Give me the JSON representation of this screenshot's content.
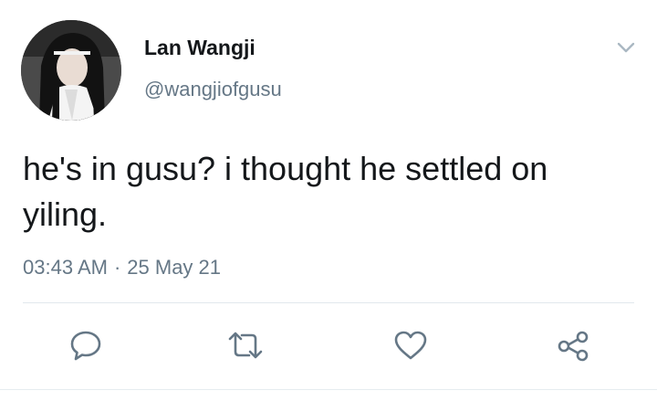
{
  "tweet": {
    "author": {
      "display_name": "Lan Wangji",
      "handle": "@wangjiofgusu",
      "avatar": "profile-photo"
    },
    "text": "he's in gusu? i thought he settled on yiling.",
    "time": "03:43 AM",
    "separator": "·",
    "date": "25 May 21",
    "menu_icon": "chevron-down-icon"
  },
  "actions": [
    {
      "name": "reply",
      "icon": "reply-icon"
    },
    {
      "name": "retweet",
      "icon": "retweet-icon"
    },
    {
      "name": "like",
      "icon": "heart-icon"
    },
    {
      "name": "share",
      "icon": "share-icon"
    }
  ],
  "colors": {
    "text_primary": "#14171a",
    "text_secondary": "#657786",
    "icon": "#657786",
    "divider": "#e1e8ed"
  }
}
